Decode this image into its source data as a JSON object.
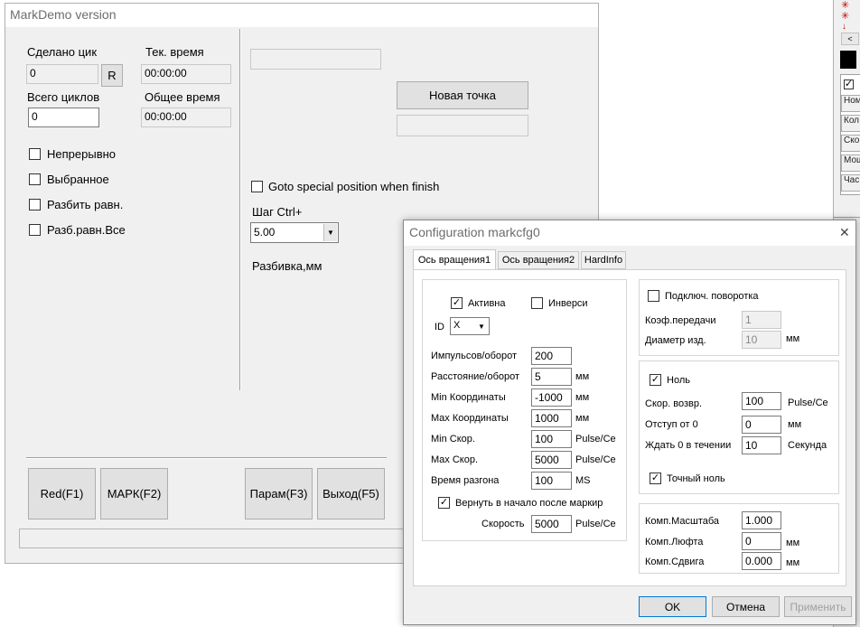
{
  "main": {
    "title": "MarkDemo version",
    "done_cycles_label": "Сделано цик",
    "done_cycles_value": "0",
    "reset_label": "R",
    "cur_time_label": "Тек. время",
    "cur_time_value": "00:00:00",
    "total_cycles_label": "Всего циклов",
    "total_cycles_value": "0",
    "total_time_label": "Общее время",
    "total_time_value": "00:00:00",
    "cb_continuous": "Непрерывно",
    "cb_selected": "Выбранное",
    "cb_split_even": "Разбить равн.",
    "cb_split_even_all": "Разб.равн.Все",
    "new_point_label": "Новая точка",
    "goto_special_label": "Goto special position when finish",
    "step_label": "Шаг Ctrl+",
    "step_value": "5.00",
    "split_mm_label": "Разбивка,мм",
    "btn_red": "Red(F1)",
    "btn_mark": "МАРК(F2)",
    "btn_param": "Парам(F3)",
    "btn_exit": "Выход(F5)"
  },
  "config": {
    "title": "Configuration markcfg0",
    "close_glyph": "✕",
    "tabs": [
      "Ось вращения1",
      "Ось вращения2",
      "HardInfo"
    ],
    "active_label": "Активна",
    "invert_label": "Инверси",
    "id_label": "ID",
    "id_value": "X",
    "pulses_label": "Импульсов/оборот",
    "pulses_value": "200",
    "distance_label": "Расстояние/оборот",
    "distance_value": "5",
    "distance_unit": "мм",
    "min_coord_label": "Min Координаты",
    "min_coord_value": "-1000",
    "min_coord_unit": "мм",
    "max_coord_label": "Max Координаты",
    "max_coord_value": "1000",
    "max_coord_unit": "мм",
    "min_speed_label": "Min Скор.",
    "min_speed_value": "100",
    "min_speed_unit": "Pulse/Ce",
    "max_speed_label": "Max Скор.",
    "max_speed_value": "5000",
    "max_speed_unit": "Pulse/Ce",
    "accel_label": "Время разгона",
    "accel_value": "100",
    "accel_unit": "MS",
    "return_start_label": "Вернуть в начало после маркир",
    "speed_label": "Скорость",
    "speed_value": "5000",
    "speed_unit": "Pulse/Ce",
    "rotator_label": "Подключ. поворотка",
    "gear_ratio_label": "Коэф.передачи",
    "gear_ratio_value": "1",
    "diameter_label": "Диаметр изд.",
    "diameter_value": "10",
    "diameter_unit": "мм",
    "zero_label": "Ноль",
    "return_speed_label": "Скор. возвр.",
    "return_speed_value": "100",
    "return_speed_unit": "Pulse/Ce",
    "offset_label": "Отступ от 0",
    "offset_value": "0",
    "offset_unit": "мм",
    "wait_label": "Ждать 0 в течении",
    "wait_value": "10",
    "wait_unit": "Секунда",
    "exact_zero_label": "Точный ноль",
    "scale_comp_label": "Комп.Масштаба",
    "scale_comp_value": "1.000",
    "backlash_label": "Комп.Люфта",
    "backlash_value": "0",
    "backlash_unit": "мм",
    "shift_label": "Комп.Сдвига",
    "shift_value": "0.000",
    "shift_unit": "мм",
    "ok_label": "OK",
    "cancel_label": "Отмена",
    "apply_label": "Применить"
  },
  "right_panel": {
    "items": [
      "Ном",
      "Кол",
      "Ско",
      "Мош",
      "Час"
    ]
  }
}
